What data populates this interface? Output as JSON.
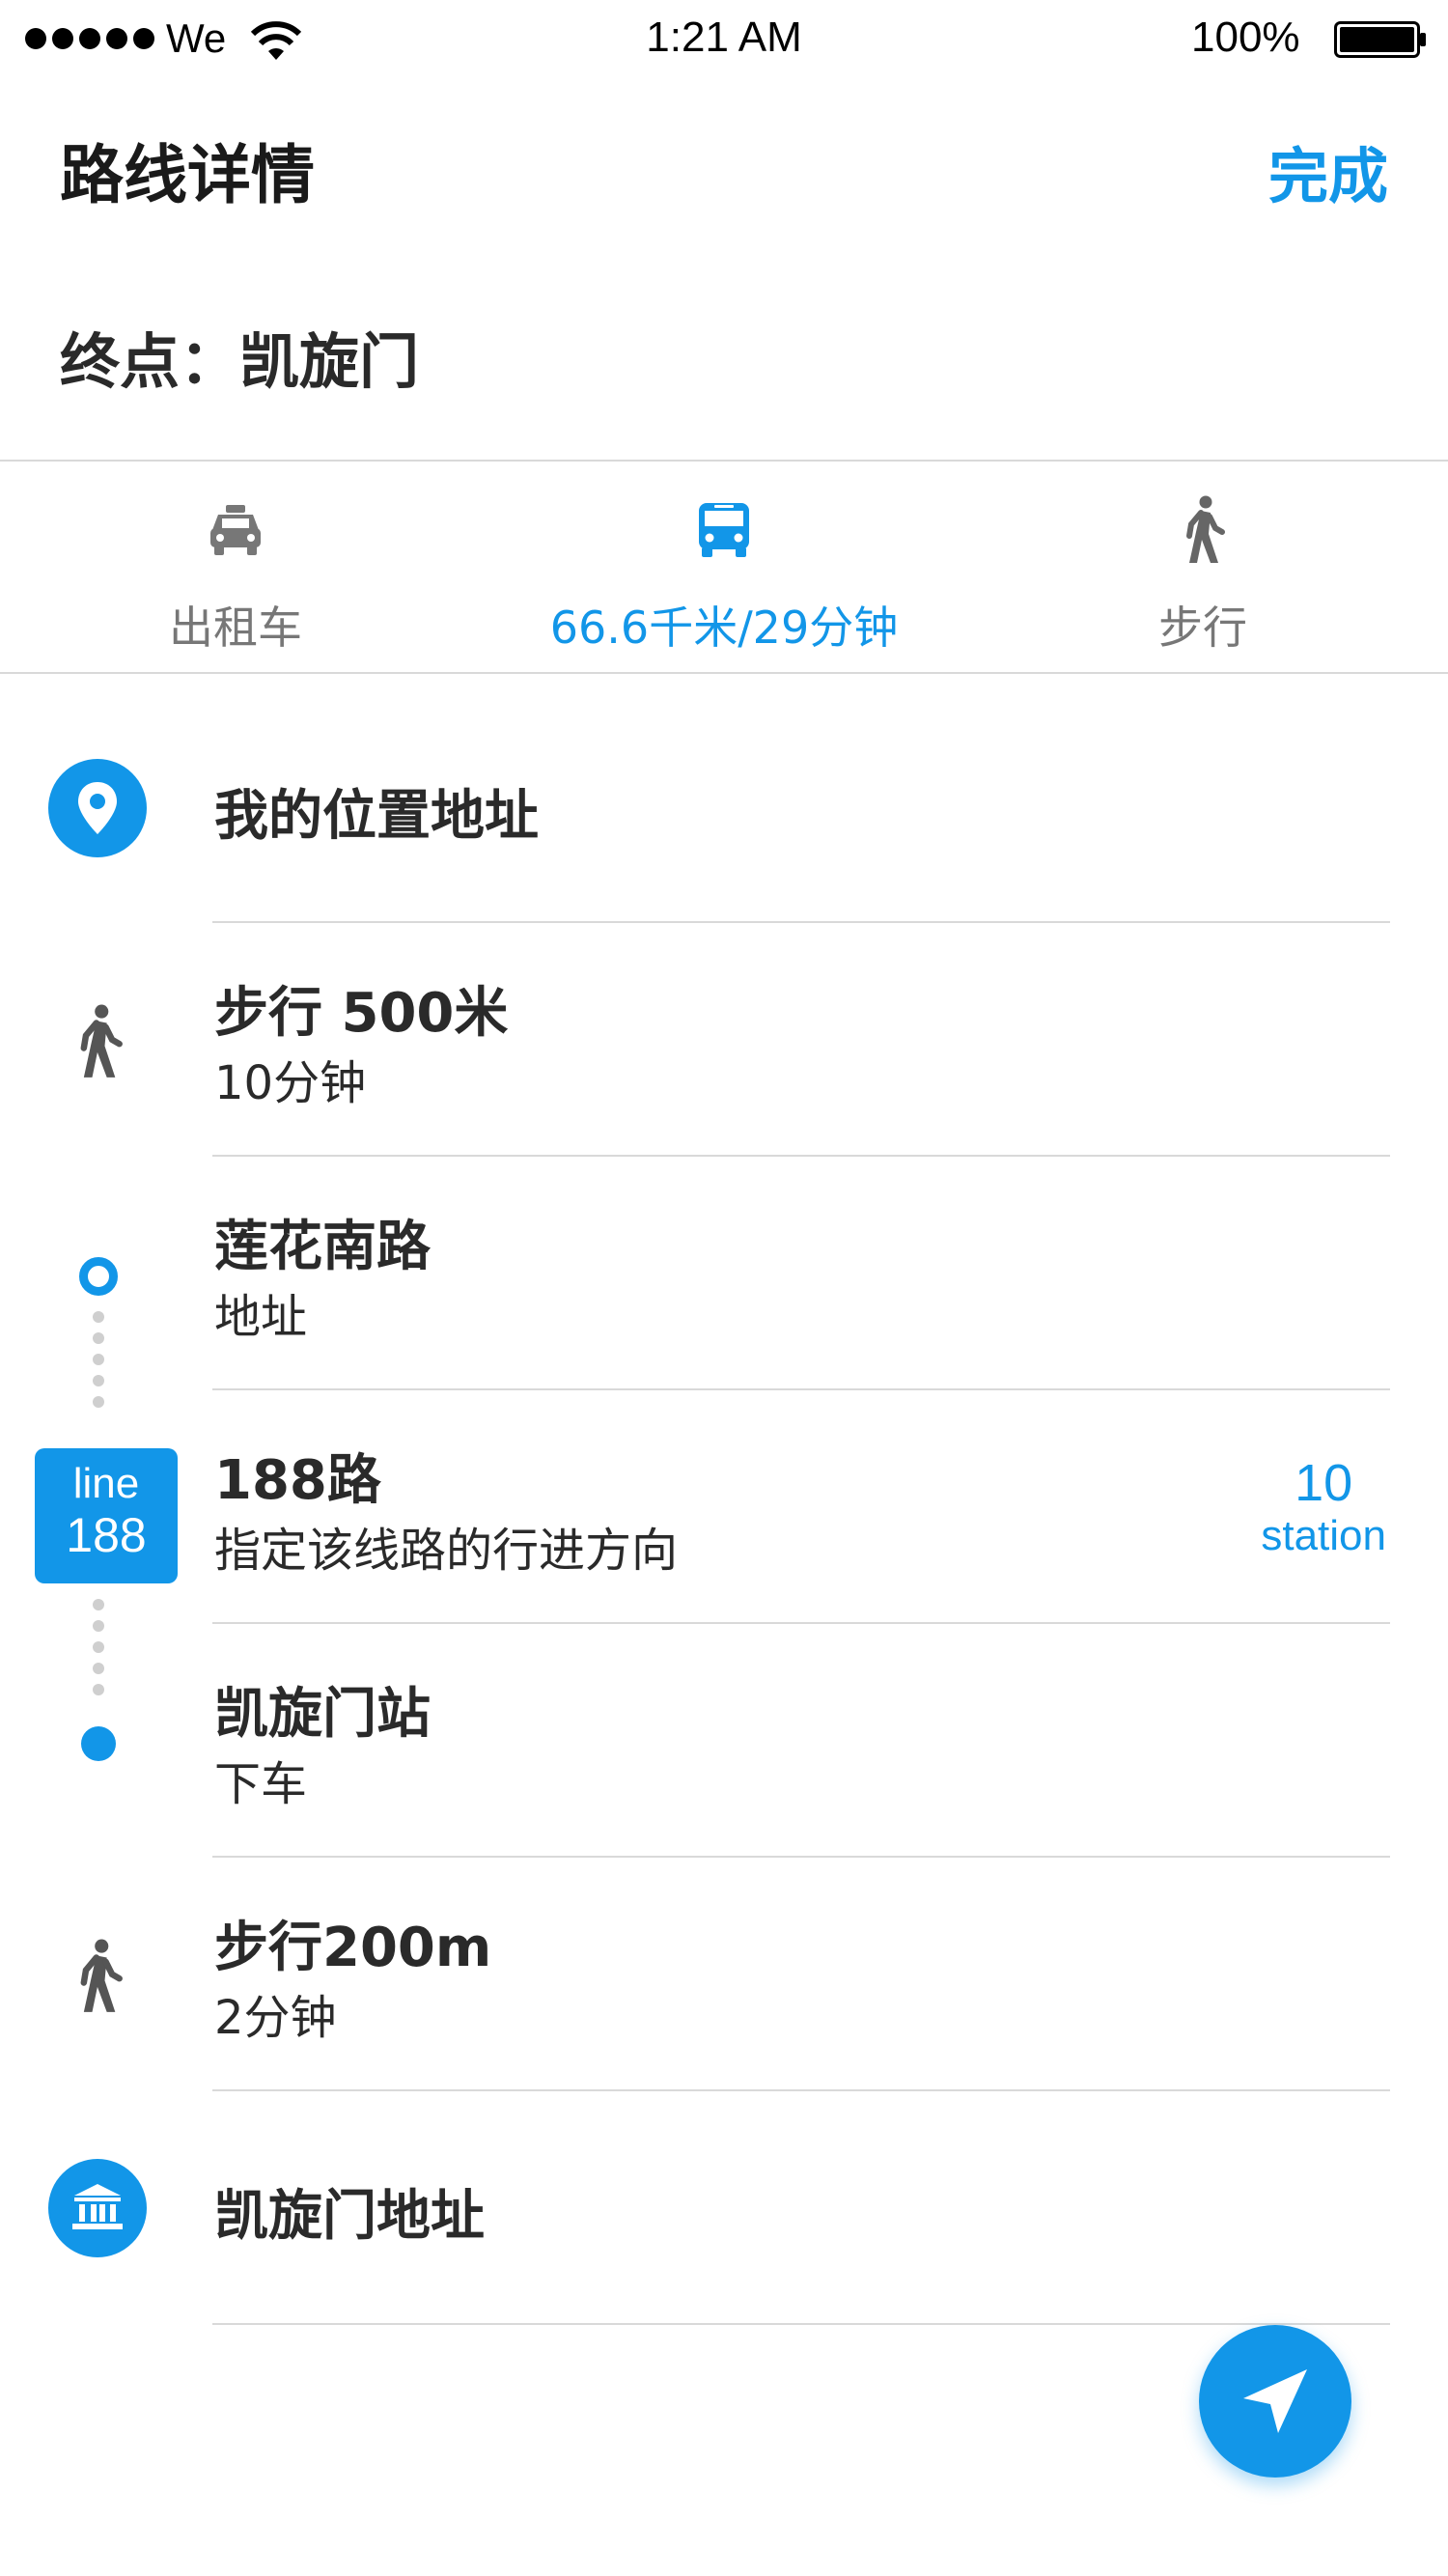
{
  "status_bar": {
    "carrier": "We",
    "time": "1:21 AM",
    "battery": "100%"
  },
  "header": {
    "title": "路线详情",
    "done_label": "完成"
  },
  "destination": {
    "label": "终点：",
    "name": "凯旋门"
  },
  "mode_tabs": [
    {
      "label": "出租车",
      "icon": "taxi-icon",
      "active": false
    },
    {
      "label": "66.6千米/29分钟",
      "icon": "bus-icon",
      "active": true
    },
    {
      "label": "步行",
      "icon": "walk-icon",
      "active": false
    }
  ],
  "route": {
    "start": {
      "title": "我的位置地址",
      "icon": "location-pin-icon"
    },
    "walk1": {
      "title": "步行 500米",
      "subtitle": "10分钟",
      "icon": "walk-icon"
    },
    "board_stop": {
      "title": "莲花南路",
      "subtitle": "地址"
    },
    "bus_line": {
      "badge_top": "line",
      "badge_bottom": "188",
      "title": "188路",
      "subtitle": "指定该线路的行进方向",
      "stop_count": "10",
      "stop_unit": "station"
    },
    "alight_stop": {
      "title": "凯旋门站",
      "subtitle": "下车"
    },
    "walk2": {
      "title": "步行200m",
      "subtitle": "2分钟",
      "icon": "walk-icon"
    },
    "end": {
      "title": "凯旋门地址",
      "icon": "landmark-icon"
    }
  },
  "colors": {
    "accent": "#1296e8",
    "text": "#2a2a2a",
    "muted": "#777777",
    "divider": "#d9d9d9"
  }
}
